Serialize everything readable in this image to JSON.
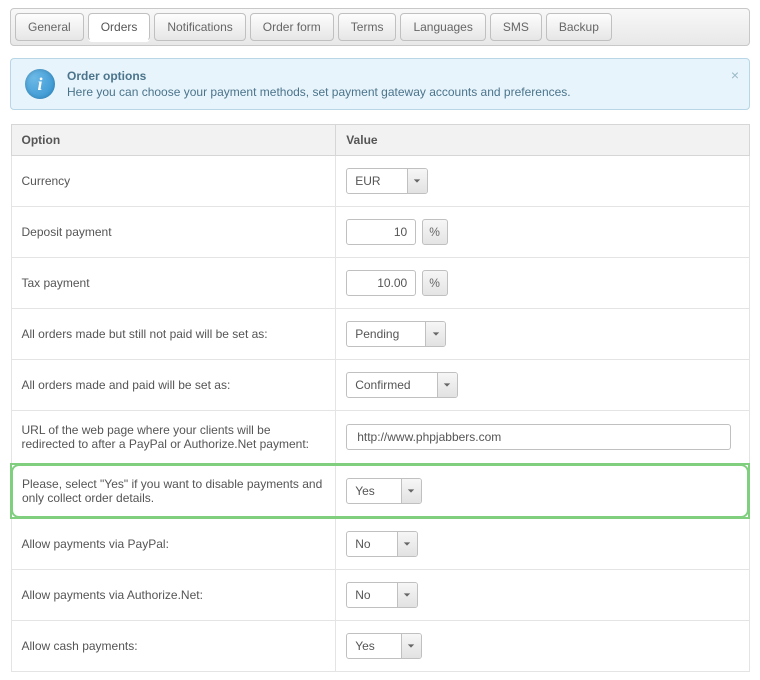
{
  "tabs": [
    "General",
    "Orders",
    "Notifications",
    "Order form",
    "Terms",
    "Languages",
    "SMS",
    "Backup"
  ],
  "active_tab_index": 1,
  "info": {
    "title": "Order options",
    "desc": "Here you can choose your payment methods, set payment gateway accounts and preferences.",
    "icon_glyph": "i",
    "close_glyph": "×"
  },
  "headers": {
    "option": "Option",
    "value": "Value"
  },
  "rows": {
    "currency": {
      "label": "Currency",
      "value": "EUR",
      "type": "select"
    },
    "deposit": {
      "label": "Deposit payment",
      "value": "10",
      "unit": "%",
      "type": "number"
    },
    "tax": {
      "label": "Tax payment",
      "value": "10.00",
      "unit": "%",
      "type": "number"
    },
    "unpaid_status": {
      "label": "All orders made but still not paid will be set as:",
      "value": "Pending",
      "type": "select"
    },
    "paid_status": {
      "label": "All orders made and paid will be set as:",
      "value": "Confirmed",
      "type": "select"
    },
    "redirect_url": {
      "label": "URL of the web page where your clients will be redirected to after a PayPal or Authorize.Net payment:",
      "value": "http://www.phpjabbers.com",
      "type": "text"
    },
    "disable_payments": {
      "label": "Please, select \"Yes\" if you want to disable payments and only collect order details.",
      "value": "Yes",
      "type": "select"
    },
    "paypal": {
      "label": "Allow payments via PayPal:",
      "value": "No",
      "type": "select"
    },
    "authorize": {
      "label": "Allow payments via Authorize.Net:",
      "value": "No",
      "type": "select"
    },
    "cash": {
      "label": "Allow cash payments:",
      "value": "Yes",
      "type": "select"
    }
  }
}
